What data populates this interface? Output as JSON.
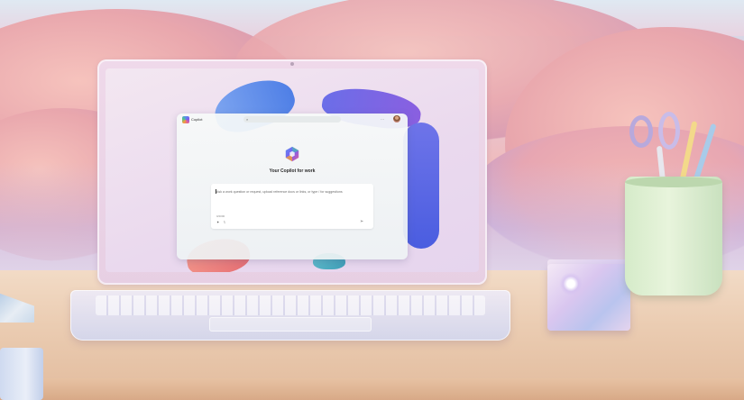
{
  "app": {
    "name": "Copilot",
    "heading": "Your Copilot for work",
    "more_label": "···"
  },
  "prompt": {
    "placeholder": "Ask a work question or request, upload reference docs or links, or type / for suggestions",
    "char_count": "0/2000",
    "attach_icon": "paperclip-icon",
    "sparkle_icon": "sparkle-icon",
    "send_icon": "send-icon"
  },
  "colors": {
    "copilot_gradient": [
      "#5b8def",
      "#7b5cf0",
      "#e2619b",
      "#f5a03b",
      "#4fc48f"
    ],
    "ribbon_blue": "#4f7fe6",
    "ribbon_violet": "#6b6ee8",
    "ribbon_coral": "#e56d73"
  }
}
